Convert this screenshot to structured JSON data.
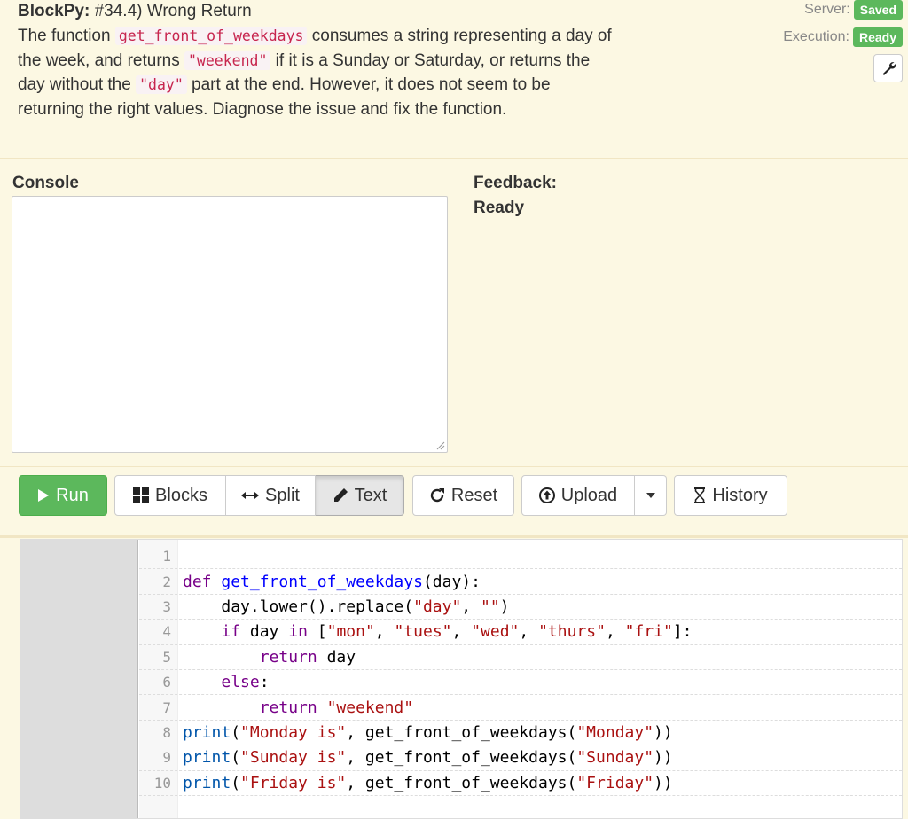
{
  "header": {
    "app_name": "BlockPy:",
    "assignment_title": "#34.4) Wrong Return",
    "desc": {
      "p1": "The function ",
      "code1": "get_front_of_weekdays",
      "p2": " consumes a string representing a day of",
      "p3": "the week, and returns ",
      "code2": "\"weekend\"",
      "p4": " if it is a Sunday or Saturday, or returns the",
      "p5": "day without the ",
      "code3": "\"day\"",
      "p6": " part at the end. However, it does not seem to be",
      "p7": "returning the right values. Diagnose the issue and fix the function."
    },
    "server_label": "Server:",
    "server_status": "Saved",
    "execution_label": "Execution:",
    "execution_status": "Ready",
    "wrench_icon": "wrench-icon"
  },
  "console": {
    "label": "Console",
    "value": ""
  },
  "feedback": {
    "label": "Feedback:",
    "text": "Ready"
  },
  "toolbar": {
    "run": "Run",
    "blocks": "Blocks",
    "split": "Split",
    "text": "Text",
    "reset": "Reset",
    "upload": "Upload",
    "history": "History",
    "active_mode": "Text"
  },
  "editor": {
    "line_numbers": [
      "1",
      "2",
      "3",
      "4",
      "5",
      "6",
      "7",
      "8",
      "9",
      "10"
    ],
    "lines": {
      "l2": {
        "kw": "def",
        "fn": "get_front_of_weekdays",
        "rest": "(day):"
      },
      "l3": {
        "a": "day.lower().replace(",
        "s1": "\"day\"",
        "b": ", ",
        "s2": "\"\"",
        "c": ")"
      },
      "l4": {
        "kw1": "if",
        "a": " day ",
        "kw2": "in",
        "b": " [",
        "s1": "\"mon\"",
        "c1": ", ",
        "s2": "\"tues\"",
        "c2": ", ",
        "s3": "\"wed\"",
        "c3": ", ",
        "s4": "\"thurs\"",
        "c4": ", ",
        "s5": "\"fri\"",
        "d": "]:"
      },
      "l5": {
        "kw": "return",
        "rest": " day"
      },
      "l6": {
        "kw": "else",
        "rest": ":"
      },
      "l7": {
        "kw": "return",
        "s": " \"weekend\""
      },
      "l8": {
        "bi": "print",
        "a": "(",
        "s1": "\"Monday is\"",
        "b": ", get_front_of_weekdays(",
        "s2": "\"Monday\"",
        "c": "))"
      },
      "l9": {
        "bi": "print",
        "a": "(",
        "s1": "\"Sunday is\"",
        "b": ", get_front_of_weekdays(",
        "s2": "\"Sunday\"",
        "c": "))"
      },
      "l10": {
        "bi": "print",
        "a": "(",
        "s1": "\"Friday is\"",
        "b": ", get_front_of_weekdays(",
        "s2": "\"Friday\"",
        "c": "))"
      }
    }
  }
}
